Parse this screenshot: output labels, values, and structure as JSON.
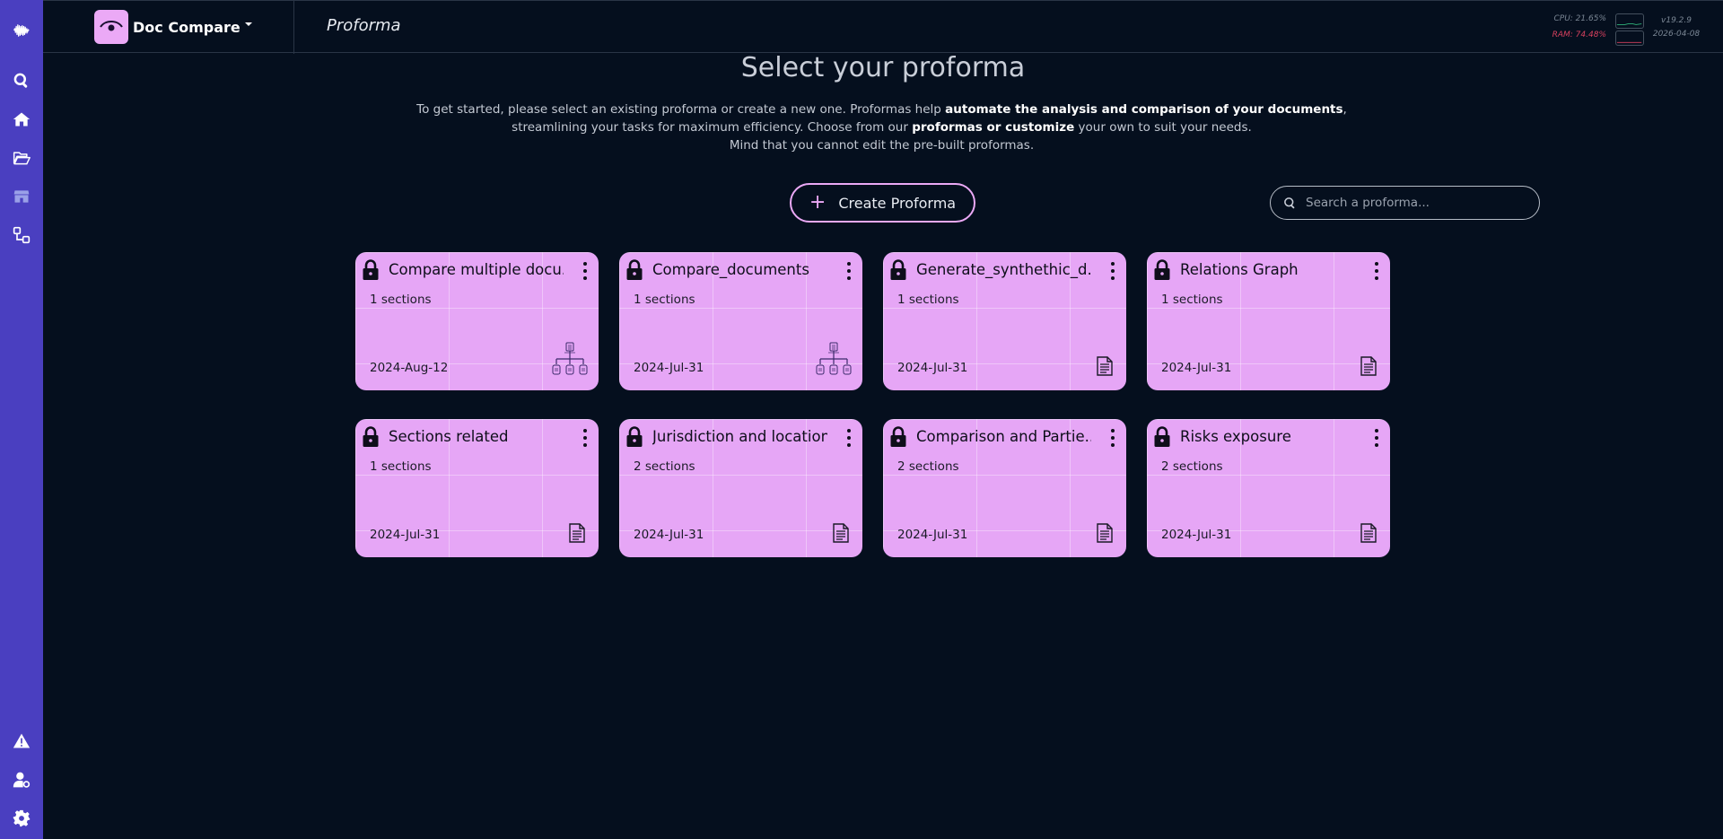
{
  "sidebar": {
    "items": [
      {
        "icon": "waveform-logo-icon"
      },
      {
        "icon": "search-icon"
      },
      {
        "icon": "home-icon"
      },
      {
        "icon": "folder-open-icon"
      },
      {
        "icon": "store-icon"
      },
      {
        "icon": "workflow-icon"
      },
      {
        "icon": "warning-icon"
      },
      {
        "icon": "user-settings-icon"
      },
      {
        "icon": "gear-icon"
      }
    ]
  },
  "header": {
    "app_name": "Doc Compare",
    "page_name": "Proforma",
    "cpu": "CPU: 21.65%",
    "ram": "RAM: 74.48%",
    "version": "v19.2.9",
    "date": "2026-04-08"
  },
  "main": {
    "title": "Select your proforma",
    "intro_part1": "To get started, please select an existing proforma or create a new one. Proformas help ",
    "intro_bold1": "automate the analysis and comparison of your documents",
    "intro_part2": ", streamlining your tasks for maximum efficiency. Choose from our ",
    "intro_bold2": "proformas or customize",
    "intro_part3": " your own to suit your needs.",
    "intro_line3": "Mind that you cannot edit the pre-built proformas.",
    "create_label": "Create Proforma",
    "search_placeholder": "Search a proforma..."
  },
  "colors": {
    "sidebar": "#4a3fc0",
    "card": "#e6a6f6",
    "background": "#050f1e",
    "accent": "#eba9f6"
  },
  "cards": [
    {
      "title": "Compare multiple docu...",
      "sections": "1 sections",
      "date": "2024-Aug-12",
      "icon": "hierarchy-icon"
    },
    {
      "title": "Compare_documents",
      "sections": "1 sections",
      "date": "2024-Jul-31",
      "icon": "hierarchy-icon"
    },
    {
      "title": "Generate_synthethic_d...",
      "sections": "1 sections",
      "date": "2024-Jul-31",
      "icon": "document-icon"
    },
    {
      "title": "Relations Graph",
      "sections": "1 sections",
      "date": "2024-Jul-31",
      "icon": "document-icon"
    },
    {
      "title": "Sections related",
      "sections": "1 sections",
      "date": "2024-Jul-31",
      "icon": "document-icon"
    },
    {
      "title": "Jurisdiction and location",
      "sections": "2 sections",
      "date": "2024-Jul-31",
      "icon": "document-icon"
    },
    {
      "title": "Comparison and Partie...",
      "sections": "2 sections",
      "date": "2024-Jul-31",
      "icon": "document-icon"
    },
    {
      "title": "Risks exposure",
      "sections": "2 sections",
      "date": "2024-Jul-31",
      "icon": "document-icon"
    }
  ]
}
